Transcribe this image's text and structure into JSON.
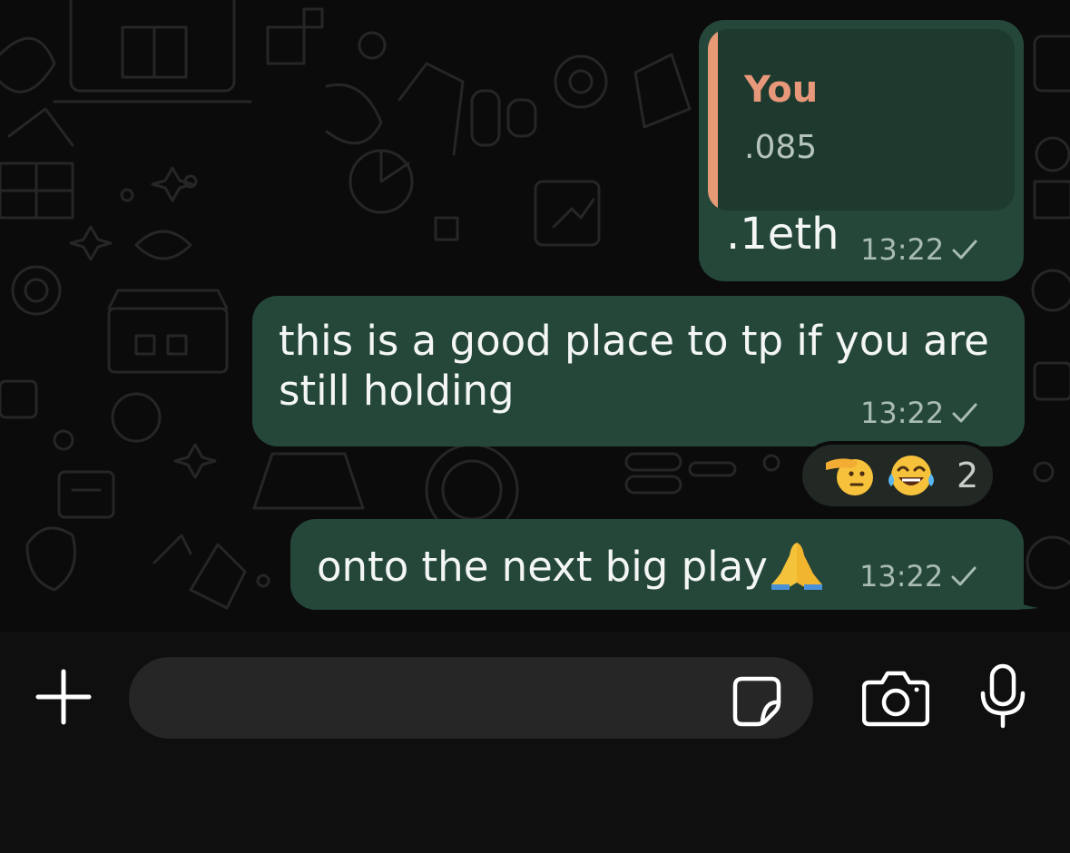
{
  "theme": {
    "chat_background": "#0b0b0b",
    "outgoing_bubble": "#25473a",
    "quote_background": "#1e3a2f",
    "quote_accent": "#e79a76",
    "input_bar_background": "#0f0f0f"
  },
  "messages": [
    {
      "type": "reply",
      "quote": {
        "author": "You",
        "text": ".085"
      },
      "text": ".1eth",
      "time": "13:22",
      "status_icon": "single-check-icon"
    },
    {
      "type": "text",
      "text": "this is a good place to tp if you are still holding",
      "time": "13:22",
      "status_icon": "single-check-icon",
      "reactions": {
        "emojis": [
          "saluting-face-emoji",
          "face-with-tears-of-joy-emoji"
        ],
        "count": "2"
      }
    },
    {
      "type": "text",
      "text": "onto the next big play",
      "emoji": "folded-hands-emoji",
      "time": "13:22",
      "status_icon": "single-check-icon"
    }
  ],
  "input_bar": {
    "message_value": "",
    "placeholder": "",
    "icons": [
      "plus-icon",
      "sticker-icon",
      "camera-icon",
      "microphone-icon"
    ]
  }
}
